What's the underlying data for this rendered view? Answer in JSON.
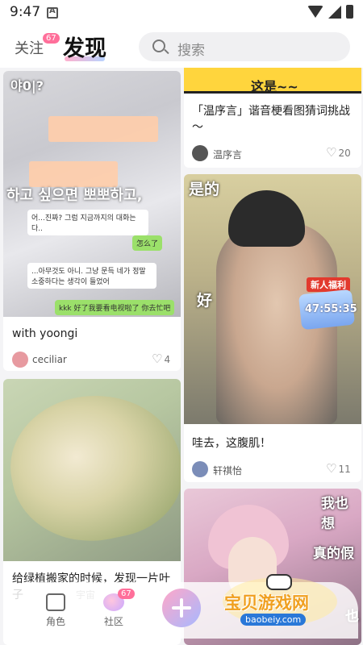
{
  "status_bar": {
    "time": "9:47"
  },
  "header": {
    "follow_label": "关注",
    "follow_badge": "67",
    "discover_label": "发现",
    "search_placeholder": "搜索"
  },
  "cards": {
    "c1": {
      "overlay_top": "야0|?",
      "bubble1": "어...진짜? 그럼 지금까지의 대화는 다..",
      "bubble2": "...아무것도 아니. 그냥 문득 네가 정말 소중하다는 생각이 들었어",
      "big_text": "하고 싶으면 뽀뽀하고,",
      "green1": "怎么了",
      "green2": "kkk 好了我要看电视啦了 你去忙吧",
      "title": "with yoongi",
      "author": "ceciliar",
      "likes": "4"
    },
    "c2": {
      "banner_text": "这是~~",
      "title": "「温序言」谐音梗看图猜词挑战～",
      "author": "温序言",
      "likes": "20"
    },
    "c3": {
      "text_top": "是的",
      "text_mid": "好",
      "gift_label": "新人福利",
      "gift_time": "47:55:35",
      "title": "哇去，这腹肌！",
      "author": "轩祺怡",
      "likes": "11"
    },
    "c4": {
      "title": "给绿植搬家的时候，发现一片叶子",
      "title_tail": "宇宙"
    },
    "c5": {
      "text1": "我也想",
      "text2": "真的假",
      "text3": "也"
    }
  },
  "bottom_nav": {
    "role_label": "角色",
    "community_label": "社区",
    "community_badge": "67"
  },
  "watermark": {
    "text": "宝贝游戏网",
    "url": "baobeiy.com"
  },
  "colors": {
    "accent_pink": "#ff6f9a",
    "banner_yellow": "#ffd53d"
  }
}
